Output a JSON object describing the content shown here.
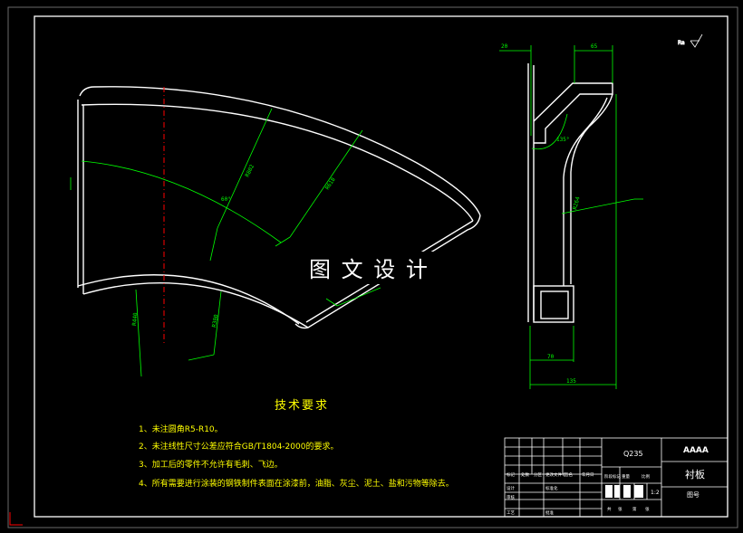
{
  "watermark": "图 文 设 计",
  "tech_requirements": {
    "title": "技术要求",
    "items": [
      "1、未注圆角R5-R10。",
      "2、未注线性尺寸公差应符合GB/T1804-2000的要求。",
      "3、加工后的零件不允许有毛刺、飞边。",
      "4、所有需要进行涂装的钢铁制件表面在涂漆前，油脂、灰尘、泥土、盐和污物等除去。"
    ]
  },
  "dimensions": {
    "angle_front": "60°",
    "r_outer_1": "R802",
    "r_outer_2": "R618",
    "r_inner_1": "R440",
    "r_inner_2": "R380",
    "side_top_left": "20",
    "side_top_right": "65",
    "side_angle": "135°",
    "side_radius": "R264",
    "side_bottom_1": "70",
    "side_bottom_2": "135"
  },
  "title_block": {
    "material": "Q235",
    "drawing_code": "AAAA",
    "part_name": "衬板",
    "drawing_no_label": "图号",
    "scale": "1:2",
    "labels": [
      "标记",
      "处数",
      "分区",
      "更改文件号",
      "签名",
      "年月日",
      "设计",
      "标准化",
      "阶段标记",
      "重量",
      "比例",
      "审核",
      "工艺",
      "批准",
      "共",
      "张",
      "第",
      "张"
    ]
  },
  "colors": {
    "background": "#000000",
    "geometry": "#ffffff",
    "dimension": "#00ff00",
    "centerline": "#ff0000",
    "text": "#ffff00",
    "border": "#ffffff",
    "accent_cyan": "#00ffff"
  }
}
